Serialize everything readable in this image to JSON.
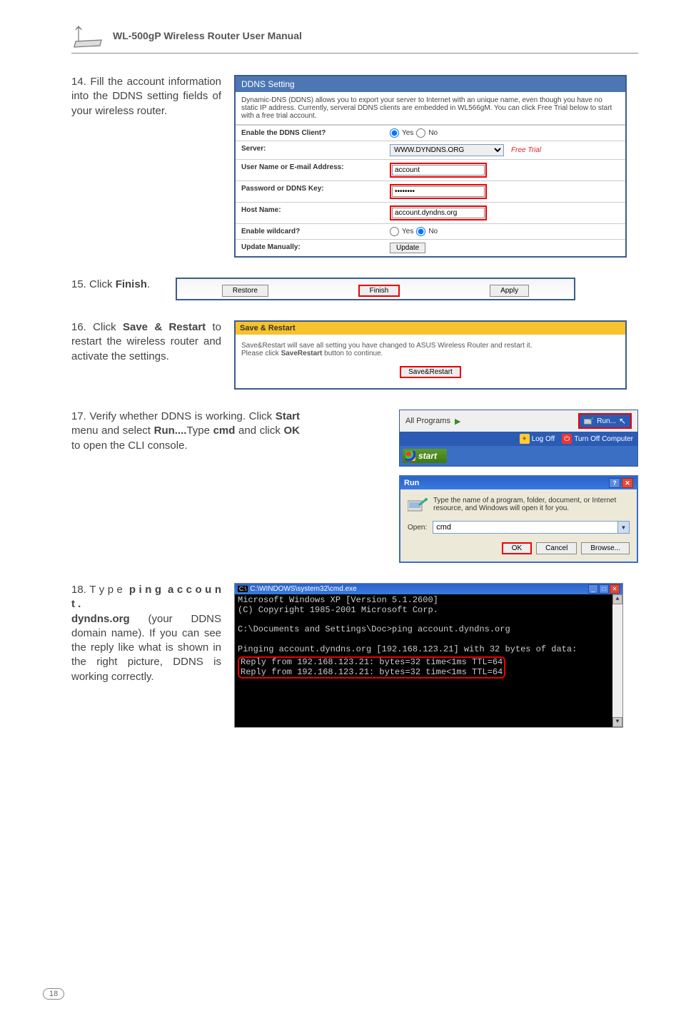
{
  "header": {
    "title": "WL-500gP Wireless Router User Manual"
  },
  "step14": {
    "text": "14. Fill the account information into the DDNS setting fields of your wireless router."
  },
  "ddns": {
    "title": "DDNS Setting",
    "desc": "Dynamic-DNS (DDNS) allows you to export your server to Internet with an unique name, even though you have no static IP address. Currently, serveral DDNS clients are embedded in WL566gM. You can click Free Trial below to start with a free trial account.",
    "rows": {
      "enable": {
        "label": "Enable the DDNS Client?",
        "yes": "Yes",
        "no": "No"
      },
      "server": {
        "label": "Server:",
        "value": "WWW.DYNDNS.ORG",
        "free": "Free Trial"
      },
      "user": {
        "label": "User Name or E-mail Address:",
        "value": "account"
      },
      "pass": {
        "label": "Password or DDNS Key:",
        "value": "••••••••"
      },
      "host": {
        "label": "Host Name:",
        "value": "account.dyndns.org"
      },
      "wildcard": {
        "label": "Enable wildcard?",
        "yes": "Yes",
        "no": "No"
      },
      "update": {
        "label": "Update Manually:",
        "btn": "Update"
      }
    }
  },
  "step15": {
    "text_prefix": "15. Click ",
    "bold": "Finish",
    "suffix": "."
  },
  "finishbar": {
    "restore": "Restore",
    "finish": "Finish",
    "apply": "Apply"
  },
  "step16": {
    "text": "16. Click Save & Restart to restart the wireless router and activate the settings."
  },
  "savebox": {
    "title": "Save & Restart",
    "body1": "Save&Restart will save all setting you have changed to ASUS Wireless Router and restart it.",
    "body2": "Please click SaveRestart button to continue.",
    "btn": "Save&Restart"
  },
  "step17": {
    "text": "17. Verify whether DDNS is working. Click Start menu and select Run....Type cmd and click OK to open the CLI console."
  },
  "startmenu": {
    "allprograms": "All Programs",
    "run": "Run...",
    "logoff": "Log Off",
    "turnoff": "Turn Off Computer",
    "start": "start"
  },
  "rundialog": {
    "title": "Run",
    "desc": "Type the name of a program, folder, document, or Internet resource, and Windows will open it for you.",
    "openlabel": "Open:",
    "value": "cmd",
    "ok": "OK",
    "cancel": "Cancel",
    "browse": "Browse..."
  },
  "step18": {
    "text": "18. Type ping account.dyndns.org (your DDNS domain name). If you can see the reply like what is shown in the right picture, DDNS is working correctly."
  },
  "cmd": {
    "title": "C:\\WINDOWS\\system32\\cmd.exe",
    "line1": "Microsoft Windows XP [Version 5.1.2600]",
    "line2": "(C) Copyright 1985-2001 Microsoft Corp.",
    "line3": "C:\\Documents and Settings\\Doc>ping account.dyndns.org",
    "line4": "Pinging account.dyndns.org [192.168.123.21] with 32 bytes of data:",
    "reply1": "Reply from 192.168.123.21: bytes=32 time<1ms TTL=64",
    "reply2": "Reply from 192.168.123.21: bytes=32 time<1ms TTL=64"
  },
  "page_number": "18"
}
